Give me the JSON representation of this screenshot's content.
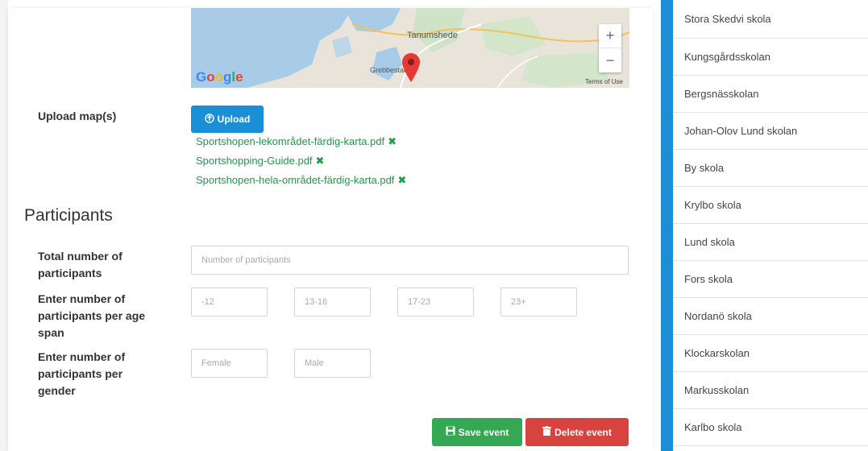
{
  "map": {
    "labels": {
      "town1": "Tanumshede",
      "town2": "Grebbestad"
    },
    "zoom_in": "+",
    "zoom_out": "−",
    "google_logo": "Google",
    "terms": "Terms of Use"
  },
  "upload": {
    "label": "Upload map(s)",
    "button_label": "Upload",
    "files": [
      {
        "name": "Sportshopen-lekområdet-färdig-karta.pdf",
        "remove": "✖"
      },
      {
        "name": "Sportshopping-Guide.pdf",
        "remove": "✖"
      },
      {
        "name": "Sportshopen-hela-området-färdig-karta.pdf",
        "remove": "✖"
      }
    ]
  },
  "participants": {
    "title": "Participants",
    "total_label": "Total number of participants",
    "total_placeholder": "Number of participants",
    "age_label": "Enter number of participants per age span",
    "age_placeholders": [
      "-12",
      "13-16",
      "17-23",
      "23+"
    ],
    "gender_label": "Enter number of participants per gender",
    "gender_placeholders": [
      "Female",
      "Male"
    ]
  },
  "actions": {
    "save_label": "Save event",
    "delete_label": "Delete event"
  },
  "schools": [
    "Stora Skedvi skola",
    "Kungsgårdsskolan",
    "Bergsnässkolan",
    "Johan-Olov Lund skolan",
    "By skola",
    "Krylbo skola",
    "Lund skola",
    "Fors skola",
    "Nordanö skola",
    "Klockarskolan",
    "Markusskolan",
    "Karlbo skola"
  ],
  "colors": {
    "primary": "#1a8fd6",
    "success": "#35a853",
    "danger": "#d9433f",
    "file_link": "#1d9a4a"
  }
}
